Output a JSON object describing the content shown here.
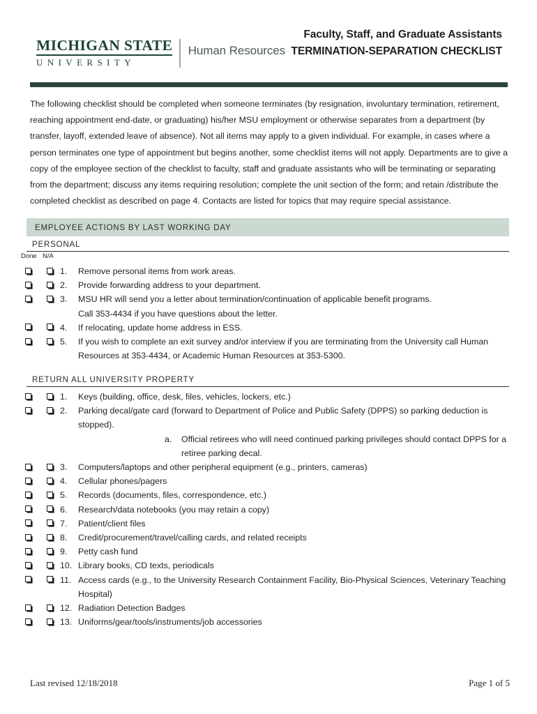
{
  "header": {
    "logo": {
      "line1": "MICHIGAN STATE",
      "line2": "UNIVERSITY",
      "unit": "Human Resources"
    },
    "title_line1": "Faculty, Staff, and Graduate Assistants",
    "title_line2": "TERMINATION-SEPARATION CHECKLIST"
  },
  "intro": "The following checklist should be completed when someone terminates (by resignation, involuntary termination, retirement, reaching appointment end-date, or graduating) his/her MSU employment or otherwise separates from a department (by transfer, layoff, extended leave of absence).  Not all items may apply to a given individual.  For example, in cases where a person terminates one type of appointment but begins another, some checklist items will not apply. Departments are to give a copy of the employee section of the checklist to faculty, staff and graduate assistants who will be terminating or separating from the department; discuss any items requiring resolution; complete the unit section of the form; and retain /distribute the completed checklist as described on page 4.  Contacts are listed for topics that may require special assistance.",
  "section_bar": {
    "label": "EMPLOYEE ACTIONS BY LAST WORKING DAY"
  },
  "columns": {
    "done": "Done",
    "na": "N/A"
  },
  "subsections": [
    {
      "title": "PERSONAL",
      "items": [
        {
          "num": "1.",
          "text": "Remove personal items from work areas."
        },
        {
          "num": "2.",
          "text": "Provide forwarding address to your department."
        },
        {
          "num": "3.",
          "text": "MSU HR will send you a letter about termination/continuation of applicable benefit programs.",
          "cont": "Call 353-4434 if you have questions about the letter."
        },
        {
          "num": "4.",
          "text": "If relocating, update home address in ESS."
        },
        {
          "num": "5.",
          "text": "If you wish to complete an exit survey and/or interview if you are terminating from the University call Human Resources at 353-4434, or Academic Human Resources at 353-5300."
        }
      ]
    },
    {
      "title": "RETURN ALL UNIVERSITY PROPERTY",
      "items": [
        {
          "num": "1.",
          "text": "Keys (building, office, desk, files, vehicles, lockers, etc.)"
        },
        {
          "num": "2.",
          "text": "Parking decal/gate card (forward to Department of Police and Public Safety (DPPS) so parking deduction is stopped).",
          "subitems": [
            {
              "letter": "a.",
              "text": "Official retirees who will need continued parking privileges should contact DPPS for a retiree parking decal."
            }
          ]
        },
        {
          "num": "3.",
          "text": "Computers/laptops and other peripheral equipment (e.g., printers, cameras)"
        },
        {
          "num": "4.",
          "text": "Cellular phones/pagers"
        },
        {
          "num": "5.",
          "text": "Records (documents, files, correspondence, etc.)"
        },
        {
          "num": "6.",
          "text": "Research/data notebooks (you may retain a copy)"
        },
        {
          "num": "7.",
          "text": "Patient/client files"
        },
        {
          "num": "8.",
          "text": "Credit/procurement/travel/calling cards, and related receipts"
        },
        {
          "num": "9.",
          "text": "Petty cash fund"
        },
        {
          "num": "10.",
          "text": "Library books, CD texts, periodicals"
        },
        {
          "num": "11.",
          "text": "Access cards (e.g., to the University Research Containment Facility, Bio-Physical Sciences, Veterinary Teaching Hospital)"
        },
        {
          "num": "12.",
          "text": "Radiation Detection Badges"
        },
        {
          "num": "13.",
          "text": "Uniforms/gear/tools/instruments/job accessories"
        }
      ]
    }
  ],
  "footer": {
    "revised": "Last revised 12/18/2018",
    "page": "Page 1 of 5"
  },
  "colors": {
    "msu_green": "#1d4438",
    "rule_dark": "#2b453c",
    "section_bar": "#ccd9d1",
    "text": "#231f20"
  }
}
